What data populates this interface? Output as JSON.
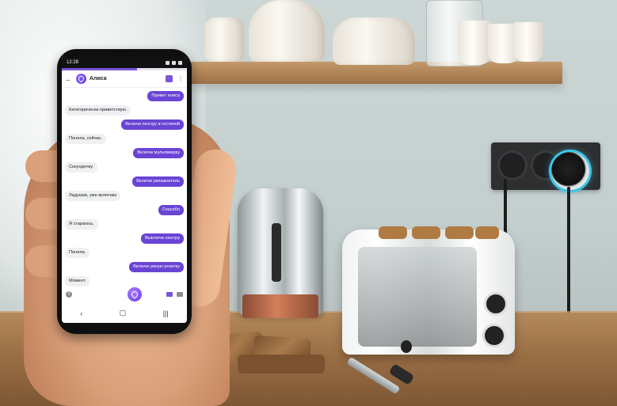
{
  "status_bar": {
    "time": "12:28"
  },
  "app_bar": {
    "title": "Алиса",
    "back_icon": "arrow-left-icon",
    "more_icon": "more-vertical-icon"
  },
  "accent_color": "#6a44d4",
  "messages": [
    {
      "from": "user",
      "text": "Привет алиса"
    },
    {
      "from": "alice",
      "text": "Категорически приветствую."
    },
    {
      "from": "user",
      "text": "Включи люстру в гостиной"
    },
    {
      "from": "alice",
      "text": "Поняла, сейчас."
    },
    {
      "from": "user",
      "text": "Включи мультиварку"
    },
    {
      "from": "alice",
      "text": "Секундочку."
    },
    {
      "from": "user",
      "text": "Включи увлажнитель"
    },
    {
      "from": "alice",
      "text": "Ладушки, уже включаю"
    },
    {
      "from": "user",
      "text": "Спасибо"
    },
    {
      "from": "alice",
      "text": "Я стараюсь."
    },
    {
      "from": "user",
      "text": "Выключи люстру"
    },
    {
      "from": "alice",
      "text": "Поняла."
    },
    {
      "from": "user",
      "text": "Включи умную розетку"
    },
    {
      "from": "alice",
      "text": "Момент."
    }
  ],
  "input_bar": {
    "help_icon": "question-circle-icon",
    "voice_icon": "alice-icon",
    "camera_icon": "camera-icon",
    "keyboard_icon": "keyboard-icon",
    "help_glyph": "?"
  },
  "nav_bar": {
    "back": "‹",
    "home": "▢",
    "recents": "|||"
  }
}
